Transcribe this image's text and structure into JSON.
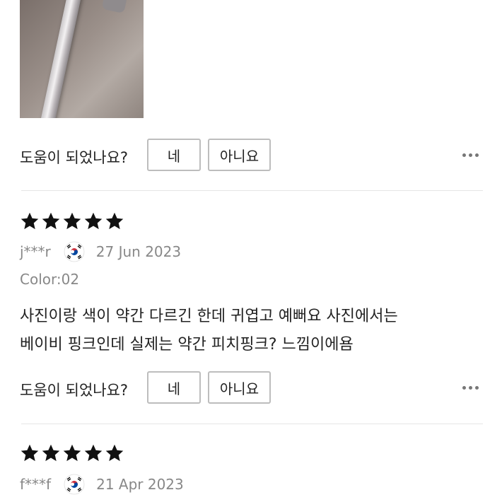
{
  "helpful": {
    "question": "도움이 되었나요?",
    "yes_label": "네",
    "no_label": "아니요"
  },
  "reviews": [
    {
      "rating": 5,
      "user": "j***r",
      "country_flag": "south-korea-flag-icon",
      "date": "27 Jun 2023",
      "color": "Color:02",
      "text_line1": "사진이랑 색이 약간 다르긴 한데 귀엽고 예뻐요 사진에서는",
      "text_line2": "베이비 핑크인데 실제는 약간 피치핑크? 느낌이에욤"
    },
    {
      "rating": 5,
      "user": "f***f",
      "country_flag": "south-korea-flag-icon",
      "date": "21 Apr 2023"
    }
  ],
  "colors": {
    "star": "#111111",
    "meta_text": "#888888",
    "border": "#bdbdbd"
  }
}
